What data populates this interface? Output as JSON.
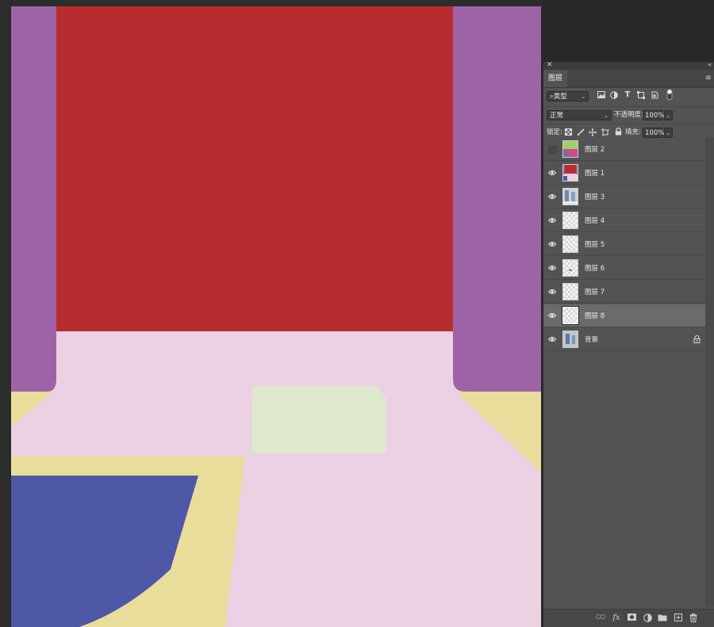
{
  "panel": {
    "tab_label": "图层",
    "filter": {
      "kind_label": "类型"
    },
    "blend": {
      "mode_label": "正常",
      "opacity_label": "不透明度:",
      "opacity_value": "100%"
    },
    "lock": {
      "lock_label": "锁定:",
      "fill_label": "填充:",
      "fill_value": "100%"
    },
    "layers": [
      {
        "name": "图层 2",
        "visible": false
      },
      {
        "name": "图层 1",
        "visible": true
      },
      {
        "name": "图层 3",
        "visible": true
      },
      {
        "name": "图层 4",
        "visible": true
      },
      {
        "name": "图层 5",
        "visible": true
      },
      {
        "name": "图层 6",
        "visible": true
      },
      {
        "name": "图层 7",
        "visible": true
      },
      {
        "name": "图层 8",
        "visible": true,
        "selected": true
      },
      {
        "name": "背景",
        "visible": true,
        "locked": true
      }
    ]
  },
  "colors": {
    "red": "#b72d2f",
    "purple": "#9e63a6",
    "pink": "#ecd0e4",
    "yellow": "#e9dd9b",
    "green": "#dde8cc",
    "blue": "#4f58a6"
  }
}
